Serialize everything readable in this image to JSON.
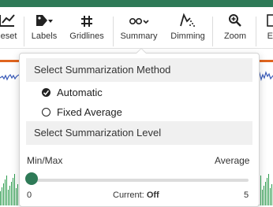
{
  "toolbar": {
    "items": [
      {
        "label": "eset",
        "icon": "reset-chart-icon"
      },
      {
        "label": "Labels",
        "icon": "tag-icon"
      },
      {
        "label": "Gridlines",
        "icon": "grid-icon"
      },
      {
        "label": "Summary",
        "icon": "summary-icon"
      },
      {
        "label": "Dimming",
        "icon": "dimming-icon"
      },
      {
        "label": "Zoom",
        "icon": "zoom-icon"
      },
      {
        "label": "Ex",
        "icon": "export-icon"
      }
    ]
  },
  "popup": {
    "method_heading": "Select Summarization Method",
    "options": [
      {
        "label": "Automatic",
        "selected": true
      },
      {
        "label": "Fixed Average",
        "selected": false
      }
    ],
    "level_heading": "Select Summarization Level",
    "slider": {
      "left_label": "Min/Max",
      "right_label": "Average",
      "min": "0",
      "max": "5",
      "current_prefix": "Current:",
      "current_value": "Off",
      "value": 0
    }
  },
  "colors": {
    "brand": "#2e7a57",
    "accent": "#e0651f",
    "plot_line": "#3a5bb8",
    "bars": "#2e9c4f"
  }
}
